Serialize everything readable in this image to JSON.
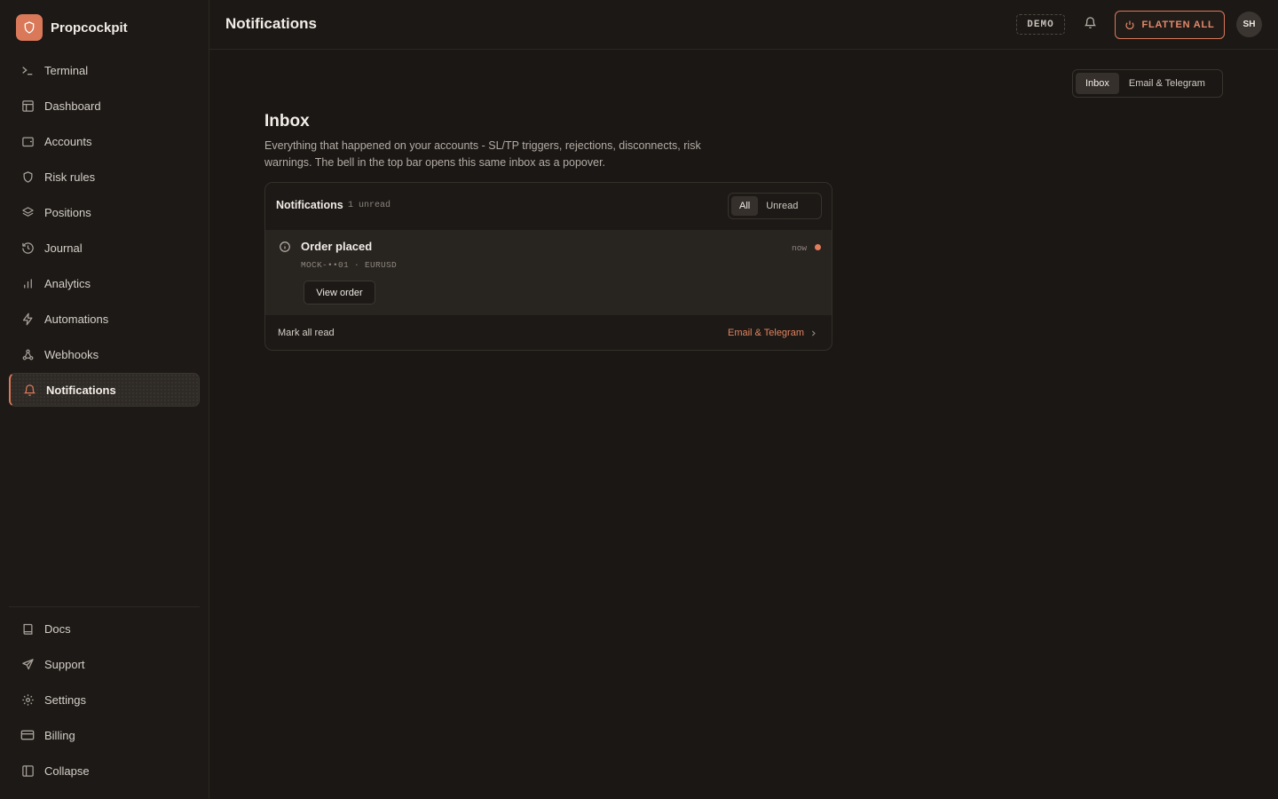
{
  "brand": {
    "name": "Propcockpit",
    "accent": "#d9795a"
  },
  "nav": {
    "items": [
      {
        "label": "Terminal",
        "icon": "terminal-icon"
      },
      {
        "label": "Dashboard",
        "icon": "layout-icon"
      },
      {
        "label": "Accounts",
        "icon": "wallet-icon"
      },
      {
        "label": "Risk rules",
        "icon": "shield-icon"
      },
      {
        "label": "Positions",
        "icon": "layers-icon"
      },
      {
        "label": "Journal",
        "icon": "history-icon"
      },
      {
        "label": "Analytics",
        "icon": "bar-chart-icon"
      },
      {
        "label": "Automations",
        "icon": "zap-icon"
      },
      {
        "label": "Webhooks",
        "icon": "webhook-icon"
      },
      {
        "label": "Notifications",
        "icon": "bell-icon",
        "active": true
      }
    ],
    "bottom": [
      {
        "label": "Docs",
        "icon": "book-icon"
      },
      {
        "label": "Support",
        "icon": "send-icon"
      },
      {
        "label": "Settings",
        "icon": "gear-icon"
      },
      {
        "label": "Billing",
        "icon": "credit-card-icon"
      },
      {
        "label": "Collapse",
        "icon": "sidebar-collapse-icon"
      }
    ]
  },
  "topbar": {
    "title": "Notifications",
    "mode_badge": "DEMO",
    "flatten_label": "FLATTEN ALL",
    "avatar_initials": "SH"
  },
  "tabs": {
    "items": [
      "Inbox",
      "Email & Telegram"
    ],
    "selected": "Inbox"
  },
  "inbox": {
    "title": "Inbox",
    "description": "Everything that happened on your accounts - SL/TP triggers, rejections, disconnects, risk warnings. The bell in the top bar opens this same inbox as a popover."
  },
  "card": {
    "title": "Notifications",
    "unread_count": "1 unread",
    "filter": {
      "all": "All",
      "unread": "Unread",
      "selected": "All"
    },
    "items": [
      {
        "title": "Order placed",
        "meta": "MOCK-••01 · EURUSD",
        "time": "now",
        "unread": true,
        "action": "View order"
      }
    ],
    "footer": {
      "mark_all": "Mark all read",
      "link": "Email & Telegram"
    }
  }
}
